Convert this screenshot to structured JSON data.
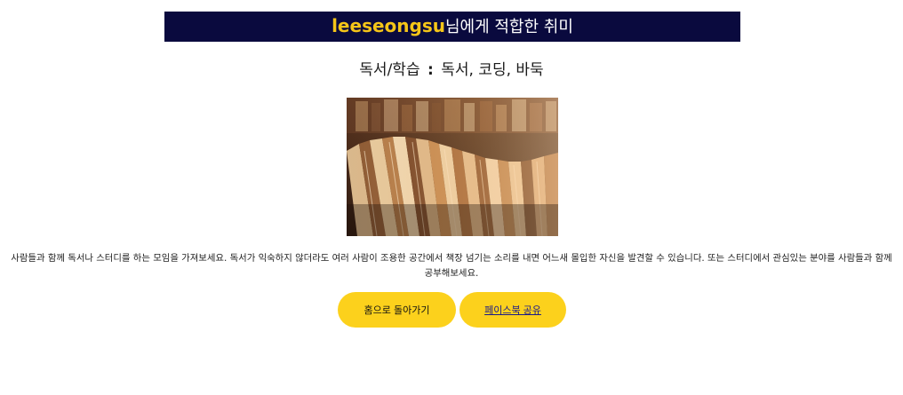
{
  "header": {
    "username": "leeseongsu",
    "title_suffix": "님에게 적합한 취미",
    "colors": {
      "background": "#0a0a3e",
      "username": "#f5c518",
      "text": "#ffffff"
    }
  },
  "category": {
    "name": "독서/학습",
    "separator": ":",
    "hobbies": "독서, 코딩, 바둑"
  },
  "image": {
    "subject": "books-photo"
  },
  "description": {
    "text": "사람들과 함께 독서나 스터디를 하는 모임을 가져보세요. 독서가 익숙하지 않더라도 여러 사람이 조용한 공간에서 책장 넘기는 소리를 내면 어느새 몰입한 자신을 발견할 수 있습니다. 또는 스터디에서 관심있는 분야를 사람들과 함께 공부해보세요."
  },
  "buttons": {
    "home_label": "홈으로 돌아가기",
    "facebook_label": "페이스북 공유",
    "color": "#fcd11c"
  }
}
